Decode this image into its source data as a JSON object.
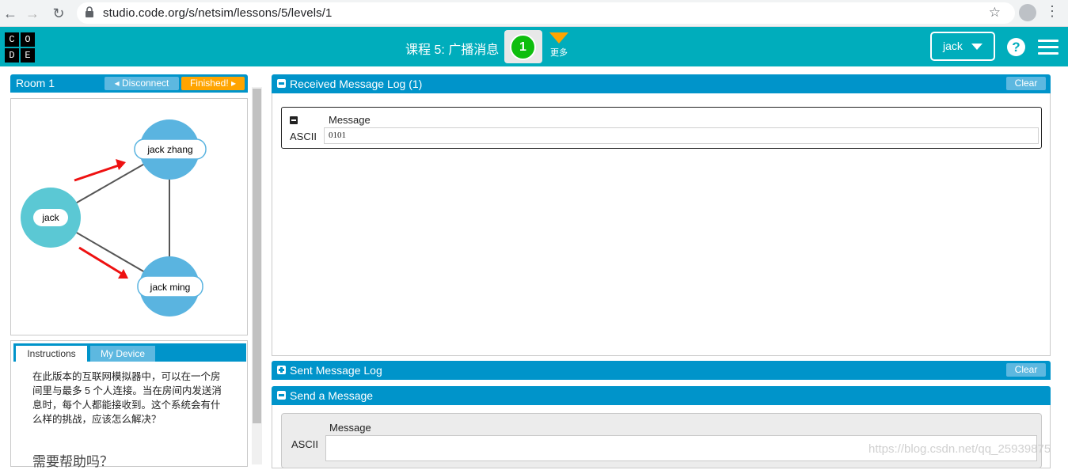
{
  "browser": {
    "back_icon": "arrow-left-icon",
    "forward_icon": "arrow-right-icon",
    "reload_icon": "reload-icon",
    "url": "studio.code.org/s/netsim/lessons/5/levels/1"
  },
  "header": {
    "logo_letters": [
      "C",
      "O",
      "D",
      "E"
    ],
    "lesson_title": "课程 5: 广播消息",
    "progress_number": "1",
    "more_label": "更多",
    "user_name": "jack",
    "colors": {
      "bar": "#00adbc",
      "progress": "#0ebe0e",
      "more": "#ffa400"
    }
  },
  "room": {
    "title": "Room 1",
    "disconnect_label": "◂ Disconnect",
    "finished_label": "Finished! ▸"
  },
  "network": {
    "nodes": [
      "jack",
      "jack zhang",
      "jack ming"
    ],
    "self_color": "#5bc8d4",
    "peer_color": "#5ab4e0",
    "arrow_color": "#ee1111"
  },
  "tabs": {
    "instructions_label": "Instructions",
    "device_label": "My Device",
    "instructions_text": "在此版本的互联网模拟器中，可以在一个房间里与最多 5 个人连接。当在房间内发送消息时，每个人都能接收到。这个系统会有什么样的挑战，应该怎么解决？",
    "need_help": "需要帮助吗？"
  },
  "received_log": {
    "title": "Received Message Log (1)",
    "clear_label": "Clear",
    "message_header": "Message",
    "encoding_label": "ASCII",
    "message_value": "0101"
  },
  "sent_log": {
    "title": "Sent Message Log",
    "clear_label": "Clear"
  },
  "send": {
    "title": "Send a Message",
    "message_header": "Message",
    "encoding_label": "ASCII",
    "input_value": ""
  },
  "watermark": "https://blog.csdn.net/qq_25939875"
}
